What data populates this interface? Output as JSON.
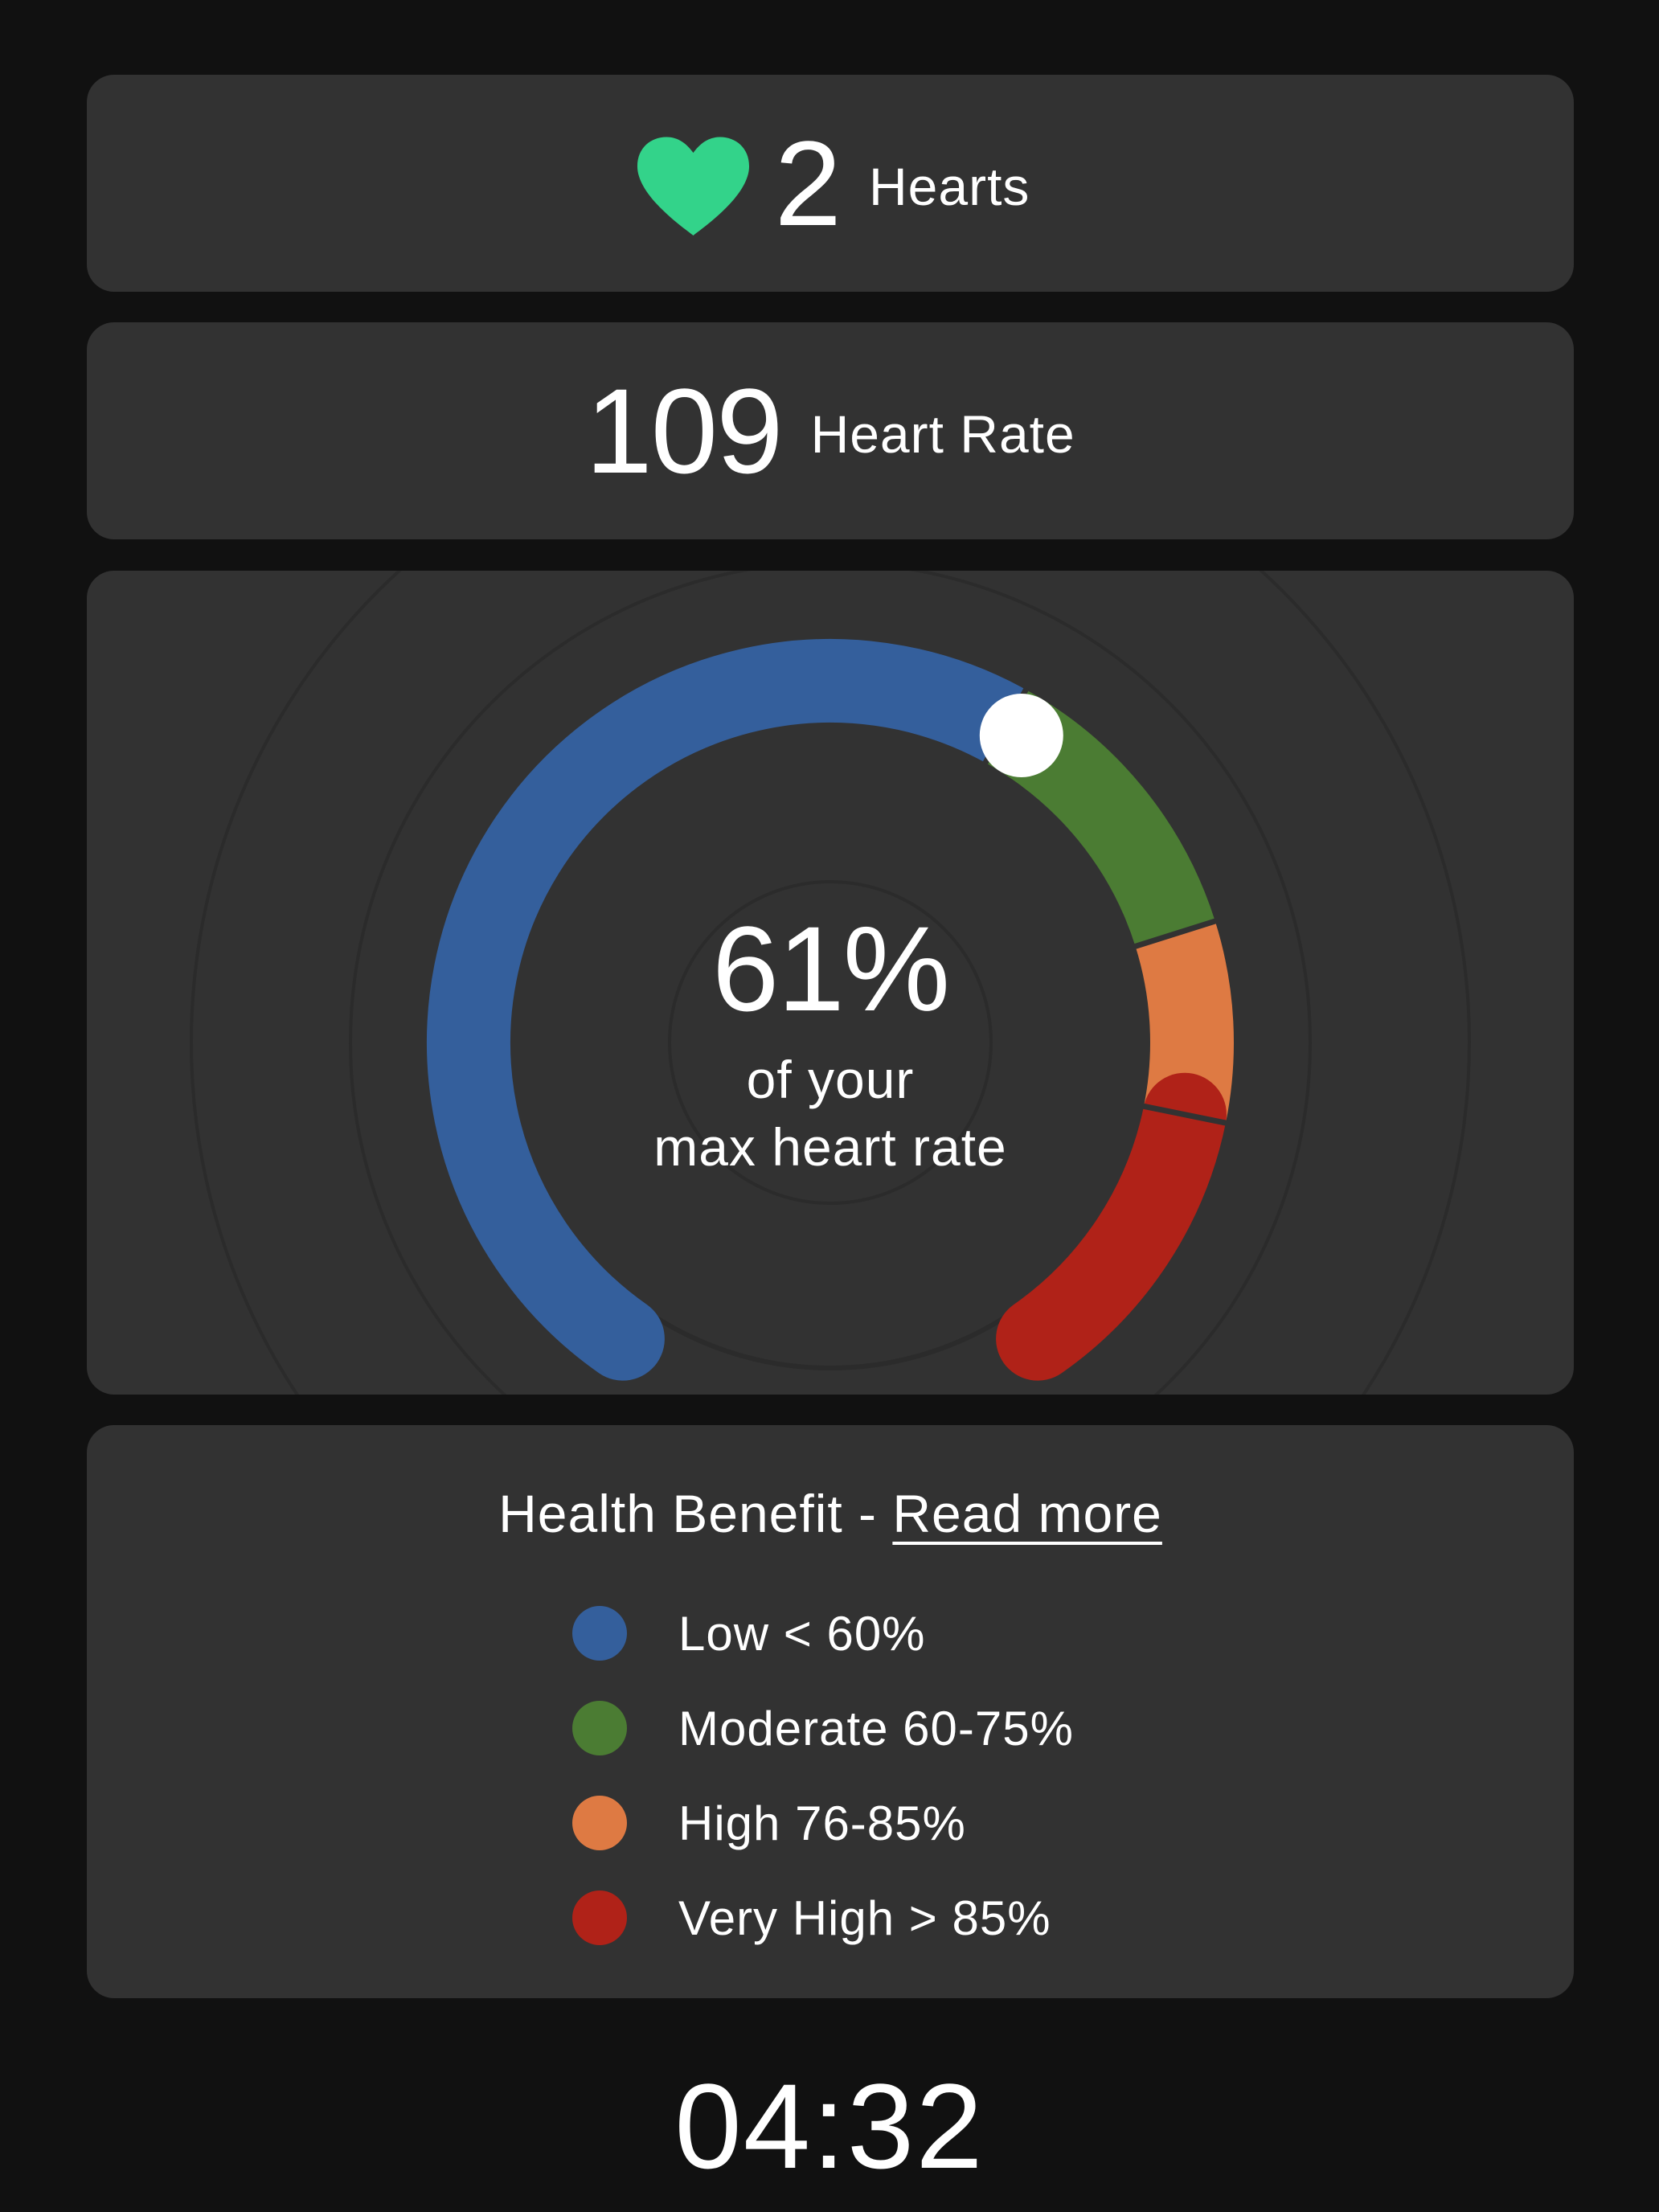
{
  "hearts": {
    "value": "2",
    "label": "Hearts",
    "icon": "heart-icon",
    "icon_color": "#33d38a"
  },
  "heart_rate": {
    "value": "109",
    "label": "Heart Rate"
  },
  "gauge": {
    "percent_text": "61%",
    "percent_value": 61,
    "sub_line_1": "of your",
    "sub_line_2": "max heart rate",
    "zones": [
      {
        "name": "Low",
        "from": 0,
        "to": 60,
        "color": "#345f9c"
      },
      {
        "name": "Moderate",
        "from": 60,
        "to": 75,
        "color": "#4b7c33"
      },
      {
        "name": "High",
        "from": 75,
        "to": 85,
        "color": "#de7a43"
      },
      {
        "name": "Very High",
        "from": 85,
        "to": 100,
        "color": "#b02218"
      }
    ],
    "indicator_color": "#ffffff"
  },
  "legend": {
    "title": "Health Benefit - ",
    "link": "Read more",
    "items": [
      {
        "label": "Low < 60%",
        "color": "#345f9c"
      },
      {
        "label": "Moderate 60-75%",
        "color": "#4b7c33"
      },
      {
        "label": "High 76-85%",
        "color": "#de7a43"
      },
      {
        "label": "Very High > 85%",
        "color": "#b02218"
      }
    ]
  },
  "timer": "04:32"
}
